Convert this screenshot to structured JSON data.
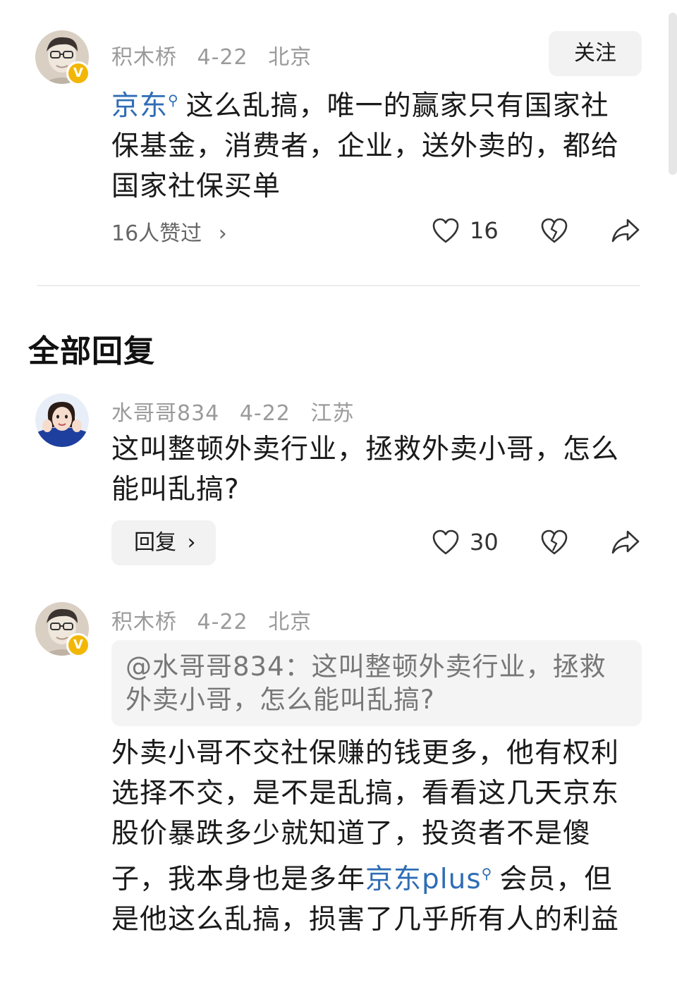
{
  "post": {
    "author": "积木桥",
    "date": "4-22",
    "location": "北京",
    "follow_label": "关注",
    "link_text": "京东",
    "text_after_link": "这么乱搞，唯一的赢家只有国家社保基金，消费者，企业，送外卖的，都给国家社保买单",
    "likers_text": "16人赞过",
    "like_count": "16"
  },
  "section_title": "全部回复",
  "replies": [
    {
      "author": "水哥哥834",
      "date": "4-22",
      "location": "江苏",
      "text": "这叫整顿外卖行业，拯救外卖小哥，怎么能叫乱搞?",
      "reply_label": "回复",
      "like_count": "30"
    },
    {
      "author": "积木桥",
      "date": "4-22",
      "location": "北京",
      "quote": "@水哥哥834：这叫整顿外卖行业，拯救外卖小哥，怎么能叫乱搞?",
      "text_before_link": "外卖小哥不交社保赚的钱更多，他有权利选择不交，是不是乱搞，看看这几天京东股价暴跌多少就知道了，投资者不是傻子，我本身也是多年",
      "link_text": "京东plus",
      "text_after_link": "会员，但是他这么乱搞，损害了几乎所有人的利益"
    }
  ],
  "badge_letter": "V",
  "colors": {
    "link": "#2f6db5",
    "badge": "#f2b705",
    "meta": "#9a9a9a",
    "button_bg": "#f2f2f2"
  },
  "icons": [
    "heart-icon",
    "broken-heart-icon",
    "share-icon",
    "search-icon",
    "chevron-right-icon",
    "verified-badge-icon"
  ]
}
